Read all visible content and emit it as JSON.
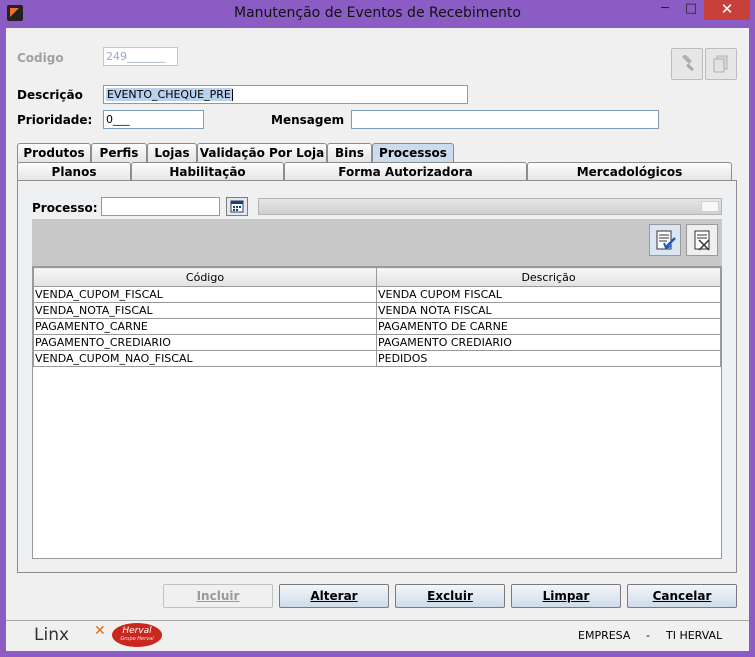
{
  "window": {
    "title": "Manutenção de Eventos de Recebimento",
    "min": "─",
    "max": "□",
    "close": "✕"
  },
  "form": {
    "codigo_label": "Codigo",
    "codigo_value": "249_______",
    "descricao_label": "Descrição",
    "descricao_value": "EVENTO_CHEQUE_PRE",
    "prioridade_label": "Prioridade:",
    "prioridade_value": "0___",
    "mensagem_label": "Mensagem",
    "mensagem_value": ""
  },
  "tabs_row1": [
    "Produtos",
    "Perfis",
    "Lojas",
    "Validação Por Loja",
    "Bins",
    "Processos"
  ],
  "tabs_row2": [
    "Planos",
    "Habilitação",
    "Forma Autorizadora",
    "Mercadológicos"
  ],
  "active_tab": "Processos",
  "processo": {
    "label": "Processo:",
    "value": ""
  },
  "table": {
    "headers": [
      "Código",
      "Descrição"
    ],
    "rows": [
      [
        "VENDA_CUPOM_FISCAL",
        "VENDA CUPOM FISCAL"
      ],
      [
        "VENDA_NOTA_FISCAL",
        "VENDA NOTA FISCAL"
      ],
      [
        "PAGAMENTO_CARNE",
        "PAGAMENTO DE CARNE"
      ],
      [
        "PAGAMENTO_CREDIARIO",
        "PAGAMENTO CREDIARIO"
      ],
      [
        "VENDA_CUPOM_NAO_FISCAL",
        "PEDIDOS"
      ]
    ]
  },
  "actions": {
    "incluir": "Incluir",
    "alterar": "Alterar",
    "excluir": "Excluir",
    "limpar": "Limpar",
    "cancelar": "Cancelar"
  },
  "footer": {
    "brand1": "Linx",
    "brand2": "Herval",
    "brand2_sub": "Grupo Herval",
    "empresa_label": "EMPRESA",
    "separator": "-",
    "empresa_value": "TI HERVAL"
  },
  "colors": {
    "titlebar": "#8a5cc4",
    "close": "#c7403a",
    "active_tab": "#cbdcef",
    "selection": "#b9d1ea"
  }
}
